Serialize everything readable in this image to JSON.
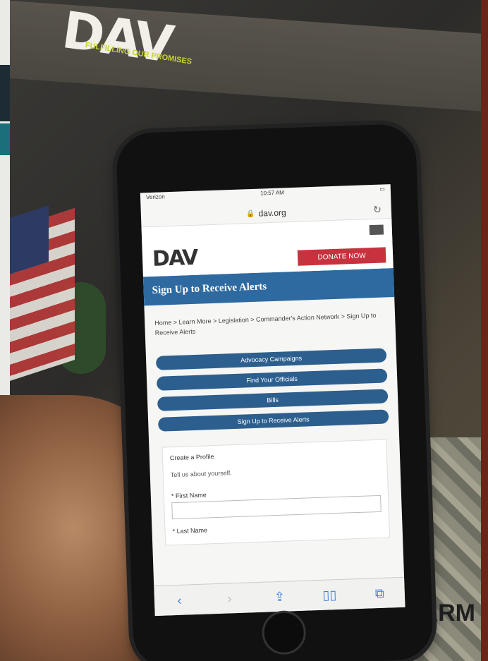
{
  "poster": {
    "logo": "DAV",
    "tagline": "FULFILLING OUR PROMISES",
    "camo_text": "ARM"
  },
  "phone": {
    "status": {
      "carrier": "Verizon",
      "time": "10:57 AM",
      "battery": ""
    },
    "url": "dav.org",
    "site": {
      "logo": "DAV",
      "donate_label": "DONATE NOW",
      "page_title": "Sign Up to Receive Alerts",
      "breadcrumb": "Home > Learn More > Legislation > Commander's Action Network > Sign Up to Receive Alerts",
      "nav_buttons": [
        "Advocacy Campaigns",
        "Find Your Officials",
        "Bills",
        "Sign Up to Receive Alerts"
      ],
      "form": {
        "heading": "Create a Profile",
        "subheading": "Tell us about yourself.",
        "first_name_label": "* First Name",
        "last_name_label": "* Last Name"
      }
    },
    "toolbar_icons": [
      "back-icon",
      "forward-icon",
      "share-icon",
      "bookmarks-icon",
      "tabs-icon"
    ]
  }
}
